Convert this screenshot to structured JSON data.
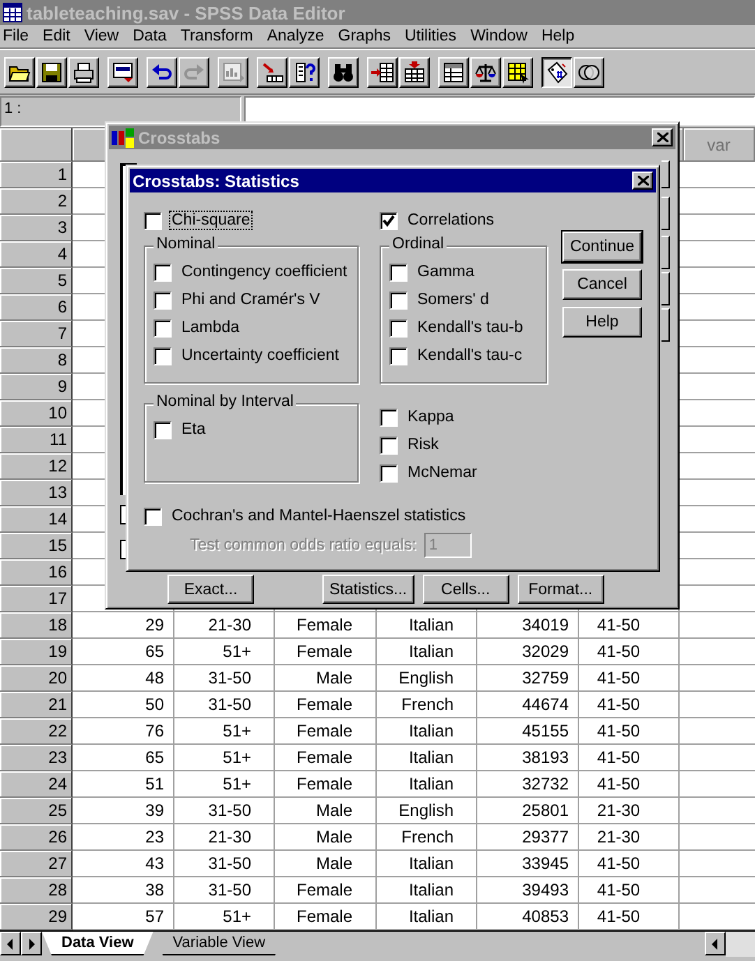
{
  "window": {
    "title": "tableteaching.sav - SPSS Data Editor"
  },
  "menu": [
    "File",
    "Edit",
    "View",
    "Data",
    "Transform",
    "Analyze",
    "Graphs",
    "Utilities",
    "Window",
    "Help"
  ],
  "toolbar_groups": [
    [
      {
        "kind": "open",
        "disabled": false,
        "on": false
      },
      {
        "kind": "save",
        "disabled": false,
        "on": false
      },
      {
        "kind": "print",
        "disabled": false,
        "on": false
      }
    ],
    [
      {
        "kind": "recall",
        "disabled": false,
        "on": false
      }
    ],
    [
      {
        "kind": "undo",
        "disabled": false,
        "on": false
      },
      {
        "kind": "redo",
        "disabled": true,
        "on": false
      }
    ],
    [
      {
        "kind": "chart",
        "disabled": true,
        "on": false
      }
    ],
    [
      {
        "kind": "goto",
        "disabled": false,
        "on": false
      },
      {
        "kind": "variables",
        "disabled": false,
        "on": false
      }
    ],
    [
      {
        "kind": "find",
        "disabled": false,
        "on": false
      }
    ],
    [
      {
        "kind": "insert_case",
        "disabled": false,
        "on": false
      },
      {
        "kind": "insert_variable",
        "disabled": false,
        "on": false
      }
    ],
    [
      {
        "kind": "split",
        "disabled": false,
        "on": false
      },
      {
        "kind": "weight",
        "disabled": false,
        "on": false
      },
      {
        "kind": "select",
        "disabled": false,
        "on": false
      }
    ],
    [
      {
        "kind": "labels",
        "disabled": false,
        "on": true
      },
      {
        "kind": "sets",
        "disabled": false,
        "on": false
      }
    ]
  ],
  "cell_editor": {
    "label": "1 :"
  },
  "grid": {
    "visible_heading": "var",
    "rows": [
      {
        "number": "1",
        "cells": []
      },
      {
        "number": "2",
        "cells": []
      },
      {
        "number": "3",
        "cells": []
      },
      {
        "number": "4",
        "cells": []
      },
      {
        "number": "5",
        "cells": []
      },
      {
        "number": "6",
        "cells": []
      },
      {
        "number": "7",
        "cells": []
      },
      {
        "number": "8",
        "cells": []
      },
      {
        "number": "9",
        "cells": []
      },
      {
        "number": "10",
        "cells": []
      },
      {
        "number": "11",
        "cells": []
      },
      {
        "number": "12",
        "cells": []
      },
      {
        "number": "13",
        "cells": []
      },
      {
        "number": "14",
        "cells": []
      },
      {
        "number": "15",
        "cells": []
      },
      {
        "number": "16",
        "cells": []
      },
      {
        "number": "17",
        "cells": []
      },
      {
        "number": "18",
        "cells": [
          "29",
          "21-30",
          "Female",
          "Italian",
          "34019",
          "41-50"
        ]
      },
      {
        "number": "19",
        "cells": [
          "65",
          "51+",
          "Female",
          "Italian",
          "32029",
          "41-50"
        ]
      },
      {
        "number": "20",
        "cells": [
          "48",
          "31-50",
          "Male",
          "English",
          "32759",
          "41-50"
        ]
      },
      {
        "number": "21",
        "cells": [
          "50",
          "31-50",
          "Female",
          "French",
          "44674",
          "41-50"
        ]
      },
      {
        "number": "22",
        "cells": [
          "76",
          "51+",
          "Female",
          "Italian",
          "45155",
          "41-50"
        ]
      },
      {
        "number": "23",
        "cells": [
          "65",
          "51+",
          "Female",
          "Italian",
          "38193",
          "41-50"
        ]
      },
      {
        "number": "24",
        "cells": [
          "51",
          "51+",
          "Female",
          "Italian",
          "32732",
          "41-50"
        ]
      },
      {
        "number": "25",
        "cells": [
          "39",
          "31-50",
          "Male",
          "English",
          "25801",
          "21-30"
        ]
      },
      {
        "number": "26",
        "cells": [
          "23",
          "21-30",
          "Male",
          "French",
          "29377",
          "21-30"
        ]
      },
      {
        "number": "27",
        "cells": [
          "43",
          "31-50",
          "Male",
          "Italian",
          "33945",
          "41-50"
        ]
      },
      {
        "number": "28",
        "cells": [
          "38",
          "31-50",
          "Female",
          "Italian",
          "39493",
          "41-50"
        ]
      },
      {
        "number": "29",
        "cells": [
          "57",
          "51+",
          "Female",
          "Italian",
          "40853",
          "41-50"
        ]
      }
    ]
  },
  "tabs": [
    {
      "label": "Data View",
      "selected": true
    },
    {
      "label": "Variable View",
      "selected": false
    }
  ],
  "crosstabs_dialog": {
    "title": "Crosstabs",
    "checkboxes": [
      {
        "checked": false
      },
      {
        "checked": false
      }
    ],
    "buttons": [
      "Exact...",
      "Statistics...",
      "Cells...",
      "Format..."
    ]
  },
  "statistics_dialog": {
    "title": "Crosstabs: Statistics",
    "top_options": [
      {
        "label": "Chi-square",
        "checked": false,
        "focused": true
      },
      {
        "label": "Correlations",
        "checked": true,
        "focused": false
      }
    ],
    "groups": [
      {
        "title": "Nominal",
        "options": [
          {
            "label": "Contingency coefficient",
            "checked": false
          },
          {
            "label": "Phi and Cramér's V",
            "checked": false
          },
          {
            "label": "Lambda",
            "checked": false
          },
          {
            "label": "Uncertainty coefficient",
            "checked": false
          }
        ]
      },
      {
        "title": "Ordinal",
        "options": [
          {
            "label": "Gamma",
            "checked": false
          },
          {
            "label": "Somers' d",
            "checked": false
          },
          {
            "label": "Kendall's tau-b",
            "checked": false
          },
          {
            "label": "Kendall's tau-c",
            "checked": false
          }
        ]
      },
      {
        "title": "Nominal by Interval",
        "options": [
          {
            "label": "Eta",
            "checked": false
          }
        ]
      }
    ],
    "other_options": [
      {
        "label": "Kappa",
        "checked": false
      },
      {
        "label": "Risk",
        "checked": false
      },
      {
        "label": "McNemar",
        "checked": false
      }
    ],
    "cochran": {
      "label": "Cochran's and Mantel-Haenszel statistics",
      "checked": false
    },
    "odds_ratio": {
      "label": "Test common odds ratio equals:",
      "value": "1",
      "disabled": true
    },
    "buttons": [
      {
        "label": "Continue",
        "default": true
      },
      {
        "label": "Cancel",
        "default": false
      },
      {
        "label": "Help",
        "default": false
      }
    ]
  }
}
